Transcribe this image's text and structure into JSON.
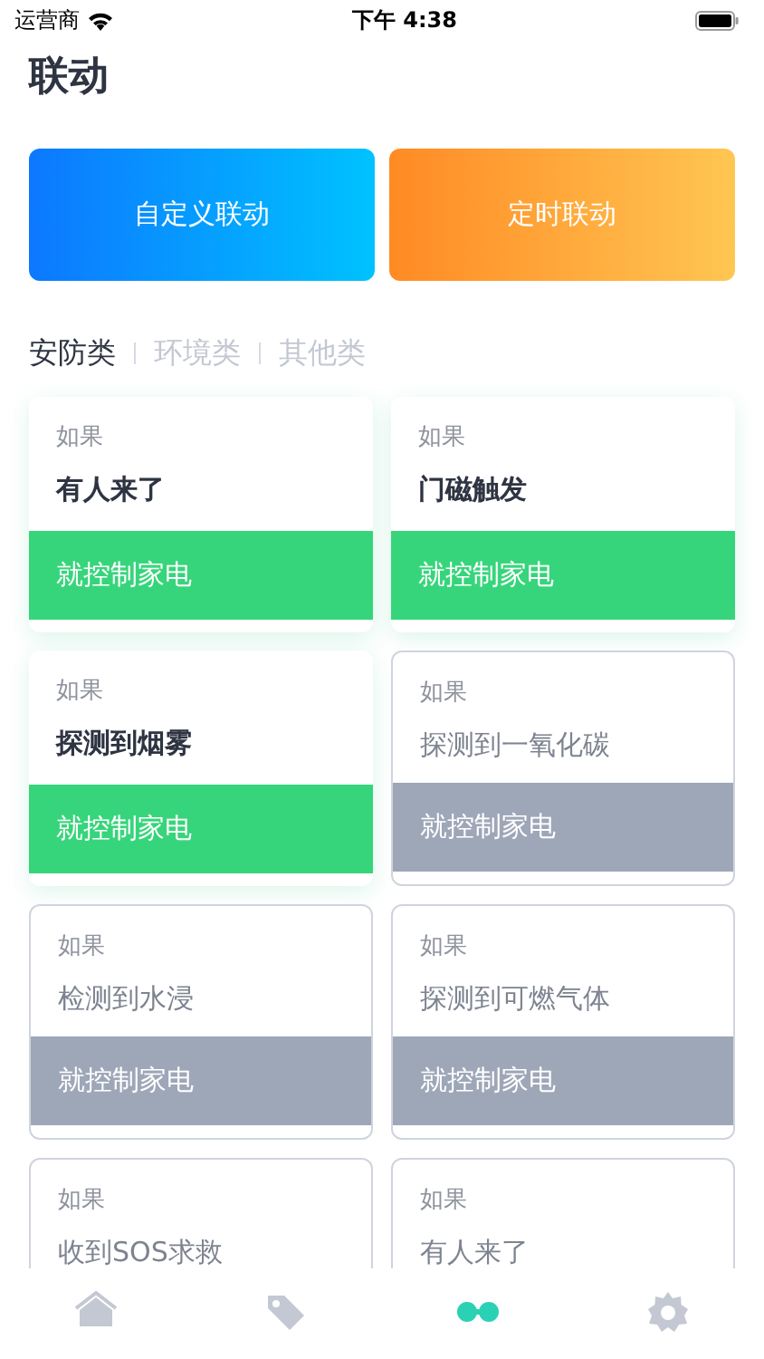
{
  "status_bar": {
    "carrier": "运营商",
    "time": "下午 4:38"
  },
  "title": "联动",
  "actions": [
    {
      "label": "自定义联动",
      "kind": "custom"
    },
    {
      "label": "定时联动",
      "kind": "timer"
    }
  ],
  "categories": [
    {
      "label": "安防类",
      "selected": true
    },
    {
      "label": "环境类",
      "selected": false
    },
    {
      "label": "其他类",
      "selected": false
    }
  ],
  "rules": [
    {
      "prefix": "如果",
      "condition": "有人来了",
      "action": "就控制家电",
      "active": true
    },
    {
      "prefix": "如果",
      "condition": "门磁触发",
      "action": "就控制家电",
      "active": true
    },
    {
      "prefix": "如果",
      "condition": "探测到烟雾",
      "action": "就控制家电",
      "active": true
    },
    {
      "prefix": "如果",
      "condition": "探测到一氧化碳",
      "action": "就控制家电",
      "active": false
    },
    {
      "prefix": "如果",
      "condition": "检测到水浸",
      "action": "就控制家电",
      "active": false
    },
    {
      "prefix": "如果",
      "condition": "探测到可燃气体",
      "action": "就控制家电",
      "active": false
    },
    {
      "prefix": "如果",
      "condition": "收到SOS求救",
      "active": false
    },
    {
      "prefix": "如果",
      "condition": "有人来了",
      "active": false
    }
  ],
  "tab_bar": [
    {
      "kind": "home",
      "selected": false
    },
    {
      "kind": "tag",
      "selected": false
    },
    {
      "kind": "linkage",
      "selected": true
    },
    {
      "kind": "settings",
      "selected": false
    }
  ]
}
